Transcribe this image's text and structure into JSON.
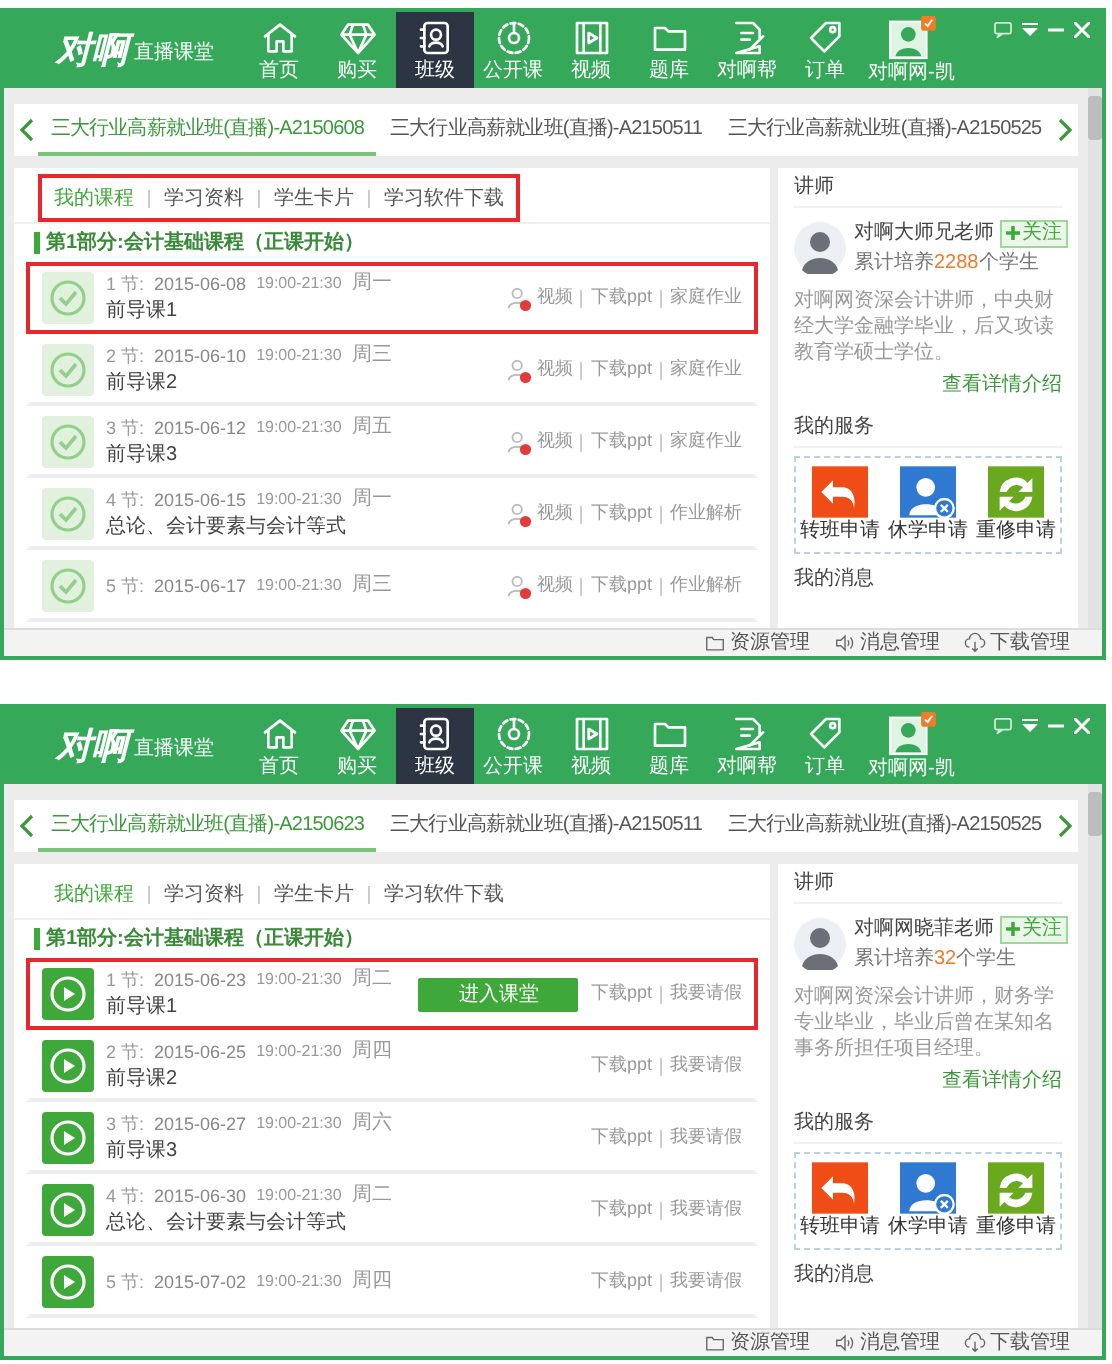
{
  "windows": [
    {
      "logo": "对啊",
      "logo_subtitle": "直播课堂",
      "nav": [
        {
          "label": "首页",
          "selected": false
        },
        {
          "label": "购买",
          "selected": false
        },
        {
          "label": "班级",
          "selected": true
        },
        {
          "label": "公开课",
          "selected": false
        },
        {
          "label": "视频",
          "selected": false
        },
        {
          "label": "题库",
          "selected": false
        },
        {
          "label": "对啊帮",
          "selected": false
        },
        {
          "label": "订单",
          "selected": false
        },
        {
          "label": "对啊网-凯",
          "selected": false
        }
      ],
      "class_tabs": [
        {
          "label": "三大行业高薪就业班(直播)-A2150608",
          "selected": true
        },
        {
          "label": "三大行业高薪就业班(直播)-A2150511",
          "selected": false
        },
        {
          "label": "三大行业高薪就业班(直播)-A2150525",
          "selected": false
        }
      ],
      "subtabs_highlighted": true,
      "subtabs": [
        {
          "label": "我的课程",
          "selected": true
        },
        {
          "label": "学习资料",
          "selected": false
        },
        {
          "label": "学生卡片",
          "selected": false
        },
        {
          "label": "学习软件下载",
          "selected": false
        }
      ],
      "section_title": "第1部分:会计基础课程（正课开始）",
      "lessons": [
        {
          "kind": "done",
          "number": "1 节:",
          "date": "2015-06-08",
          "time": "19:00-21:30",
          "weekday": "周一",
          "title": "前导课1",
          "highlighted": true,
          "locked": true,
          "actions": [
            "视频",
            "下载ppt",
            "家庭作业"
          ]
        },
        {
          "kind": "done",
          "number": "2 节:",
          "date": "2015-06-10",
          "time": "19:00-21:30",
          "weekday": "周三",
          "title": "前导课2",
          "highlighted": false,
          "locked": true,
          "actions": [
            "视频",
            "下载ppt",
            "家庭作业"
          ]
        },
        {
          "kind": "done",
          "number": "3 节:",
          "date": "2015-06-12",
          "time": "19:00-21:30",
          "weekday": "周五",
          "title": "前导课3",
          "highlighted": false,
          "locked": true,
          "actions": [
            "视频",
            "下载ppt",
            "家庭作业"
          ]
        },
        {
          "kind": "done",
          "number": "4 节:",
          "date": "2015-06-15",
          "time": "19:00-21:30",
          "weekday": "周一",
          "title": "总论、会计要素与会计等式",
          "highlighted": false,
          "locked": true,
          "actions": [
            "视频",
            "下载ppt",
            "作业解析"
          ]
        },
        {
          "kind": "done",
          "number": "5 节:",
          "date": "2015-06-17",
          "time": "19:00-21:30",
          "weekday": "周三",
          "highlighted": false,
          "locked": true,
          "actions": [
            "视频",
            "下载ppt",
            "作业解析"
          ]
        }
      ],
      "teacher": {
        "heading": "讲师",
        "name": "对啊大师兄老师",
        "follow": "关注",
        "stats_prefix": "累计培养",
        "count": "2288",
        "stats_suffix": "个学生",
        "bio": "对啊网资深会计讲师，中央财经大学金融学毕业，后又攻读教育学硕士学位。",
        "details_link": "查看详情介绍"
      },
      "services_title": "我的服务",
      "services": [
        {
          "label": "转班申请",
          "kind": "transfer"
        },
        {
          "label": "休学申请",
          "kind": "suspend"
        },
        {
          "label": "重修申请",
          "kind": "retake"
        }
      ],
      "messages_title": "我的消息",
      "bottom_bar": [
        "资源管理",
        "消息管理",
        "下载管理"
      ]
    },
    {
      "logo": "对啊",
      "logo_subtitle": "直播课堂",
      "nav": [
        {
          "label": "首页",
          "selected": false
        },
        {
          "label": "购买",
          "selected": false
        },
        {
          "label": "班级",
          "selected": true
        },
        {
          "label": "公开课",
          "selected": false
        },
        {
          "label": "视频",
          "selected": false
        },
        {
          "label": "题库",
          "selected": false
        },
        {
          "label": "对啊帮",
          "selected": false
        },
        {
          "label": "订单",
          "selected": false
        },
        {
          "label": "对啊网-凯",
          "selected": false
        }
      ],
      "class_tabs": [
        {
          "label": "三大行业高薪就业班(直播)-A2150623",
          "selected": true
        },
        {
          "label": "三大行业高薪就业班(直播)-A2150511",
          "selected": false
        },
        {
          "label": "三大行业高薪就业班(直播)-A2150525",
          "selected": false
        }
      ],
      "subtabs_highlighted": false,
      "subtabs": [
        {
          "label": "我的课程",
          "selected": true
        },
        {
          "label": "学习资料",
          "selected": false
        },
        {
          "label": "学生卡片",
          "selected": false
        },
        {
          "label": "学习软件下载",
          "selected": false
        }
      ],
      "section_title": "第1部分:会计基础课程（正课开始）",
      "lessons": [
        {
          "kind": "upcoming",
          "number": "1 节:",
          "date": "2015-06-23",
          "time": "19:00-21:30",
          "weekday": "周二",
          "title": "前导课1",
          "highlighted": true,
          "locked": false,
          "enter_button": "进入课堂",
          "actions": [
            "下载ppt",
            "我要请假"
          ]
        },
        {
          "kind": "upcoming",
          "number": "2 节:",
          "date": "2015-06-25",
          "time": "19:00-21:30",
          "weekday": "周四",
          "title": "前导课2",
          "highlighted": false,
          "locked": false,
          "actions": [
            "下载ppt",
            "我要请假"
          ]
        },
        {
          "kind": "upcoming",
          "number": "3 节:",
          "date": "2015-06-27",
          "time": "19:00-21:30",
          "weekday": "周六",
          "title": "前导课3",
          "highlighted": false,
          "locked": false,
          "actions": [
            "下载ppt",
            "我要请假"
          ]
        },
        {
          "kind": "upcoming",
          "number": "4 节:",
          "date": "2015-06-30",
          "time": "19:00-21:30",
          "weekday": "周二",
          "title": "总论、会计要素与会计等式",
          "highlighted": false,
          "locked": false,
          "actions": [
            "下载ppt",
            "我要请假"
          ]
        },
        {
          "kind": "upcoming",
          "number": "5 节:",
          "date": "2015-07-02",
          "time": "19:00-21:30",
          "weekday": "周四",
          "highlighted": false,
          "locked": false,
          "actions": [
            "下载ppt",
            "我要请假"
          ]
        }
      ],
      "teacher": {
        "heading": "讲师",
        "name": "对啊网晓菲老师",
        "follow": "关注",
        "stats_prefix": "累计培养",
        "count": "32",
        "stats_suffix": "个学生",
        "bio": "对啊网资深会计讲师，财务学专业毕业，毕业后曾在某知名事务所担任项目经理。",
        "details_link": "查看详情介绍"
      },
      "services_title": "我的服务",
      "services": [
        {
          "label": "转班申请",
          "kind": "transfer"
        },
        {
          "label": "休学申请",
          "kind": "suspend"
        },
        {
          "label": "重修申请",
          "kind": "retake"
        }
      ],
      "messages_title": "我的消息",
      "bottom_bar": [
        "资源管理",
        "消息管理",
        "下载管理"
      ]
    }
  ]
}
